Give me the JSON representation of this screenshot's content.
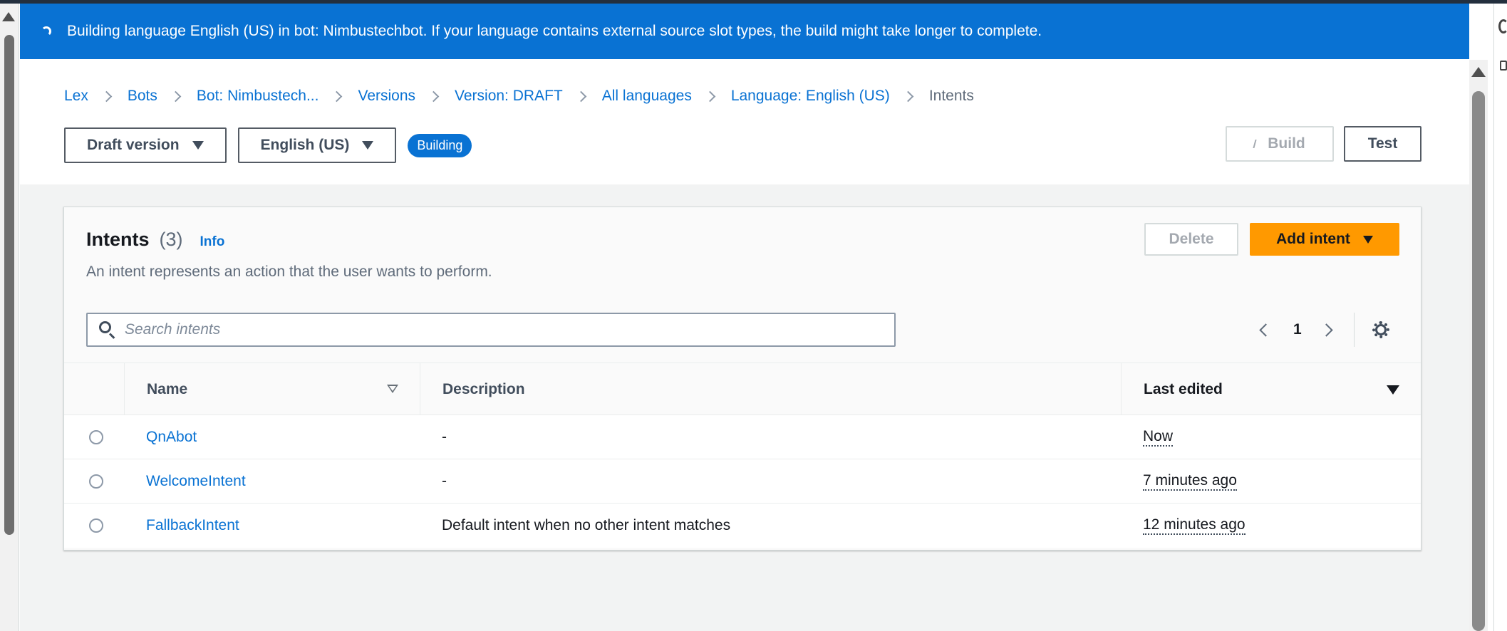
{
  "flashbar": {
    "message": "Building language English (US) in bot: Nimbustechbot. If your language contains external source slot types, the build might take longer to complete.",
    "spinner_icon": "loading-spinner-icon",
    "color": "#0972d3"
  },
  "breadcrumbs": [
    {
      "label": "Lex"
    },
    {
      "label": "Bots"
    },
    {
      "label": "Bot: Nimbustech..."
    },
    {
      "label": "Versions"
    },
    {
      "label": "Version: DRAFT"
    },
    {
      "label": "All languages"
    },
    {
      "label": "Language: English (US)"
    },
    {
      "label": "Intents"
    }
  ],
  "controls": {
    "version_select": "Draft version",
    "language_select": "English (US)",
    "status_badge": "Building",
    "build_label": "Build",
    "test_label": "Test"
  },
  "intents_panel": {
    "title": "Intents",
    "count": "(3)",
    "info_link": "Info",
    "description": "An intent represents an action that the user wants to perform.",
    "delete_label": "Delete",
    "add_label": "Add intent",
    "search_placeholder": "Search intents",
    "page": "1",
    "accent_color": "#ff9900"
  },
  "table": {
    "columns": {
      "name": "Name",
      "description": "Description",
      "last_edited": "Last edited"
    },
    "rows": [
      {
        "name": "QnAbot",
        "description": "-",
        "last_edited": "Now"
      },
      {
        "name": "WelcomeIntent",
        "description": "-",
        "last_edited": "7 minutes ago"
      },
      {
        "name": "FallbackIntent",
        "description": "Default intent when no other intent matches",
        "last_edited": "12 minutes ago"
      }
    ]
  }
}
